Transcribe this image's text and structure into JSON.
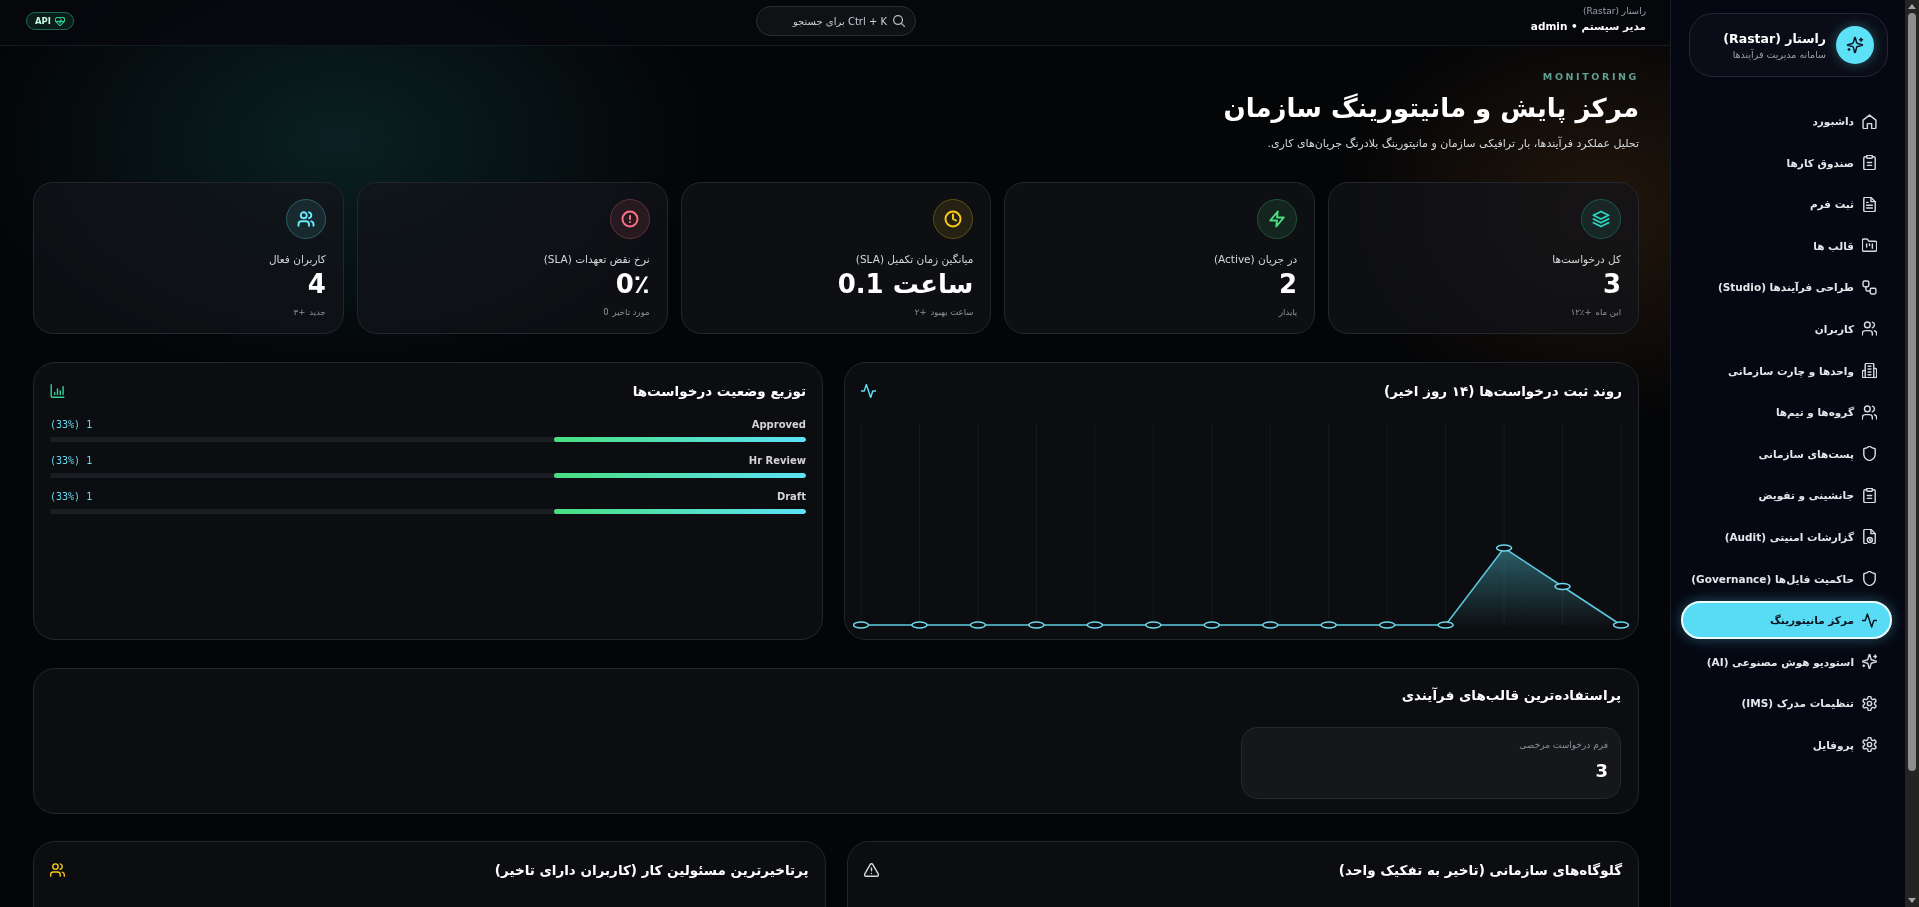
{
  "sidebar": {
    "brand": {
      "title": "راستار (Rastar)",
      "subtitle": "سامانه مدیریت فرآیندها"
    },
    "items": [
      {
        "label": "داشبورد",
        "selected": false
      },
      {
        "label": "صندوق کارها",
        "selected": false
      },
      {
        "label": "ثبت فرم",
        "selected": false
      },
      {
        "label": "قالب ها",
        "selected": false
      },
      {
        "label": "طراحی فرآیندها (Studio)",
        "selected": false
      },
      {
        "label": "کاربران",
        "selected": false
      },
      {
        "label": "واحدها و چارت سازمانی",
        "selected": false
      },
      {
        "label": "گروه‌ها و تیم‌ها",
        "selected": false
      },
      {
        "label": "پست‌های سازمانی",
        "selected": false
      },
      {
        "label": "جانشینی و تفویض",
        "selected": false
      },
      {
        "label": "گزارشات امنیتی (Audit)",
        "selected": false
      },
      {
        "label": "حاکمیت فایل‌ها (Governance)",
        "selected": false
      },
      {
        "label": "مرکز مانیتورینگ",
        "selected": true
      },
      {
        "label": "استودیو هوش مصنوعی (AI)",
        "selected": false
      },
      {
        "label": "تنظیمات مدرک (IMS)",
        "selected": false
      },
      {
        "label": "پروفایل",
        "selected": false
      }
    ]
  },
  "topbar": {
    "caption": "راستار (Rastar)",
    "user": "مدیر سیستم • admin",
    "search": {
      "placeholder": "Ctrl + K برای جستجو"
    },
    "badge": "API"
  },
  "header": {
    "eyebrow": "MONITORING",
    "title": "مرکز پایش و مانیتورینگ سازمان",
    "subtitle": "تحلیل عملکرد فرآیندها، بار ترافیکی سازمان و مانیتورینگ بلادرنگ جریان‌های کاری."
  },
  "stats": [
    {
      "label": "کل درخواست‌ها",
      "value": "3",
      "delta": "+۱۲٪",
      "note": "این ماه",
      "color": "#2dd4bf"
    },
    {
      "label": "در جریان (Active)",
      "value": "2",
      "note": "پایدار",
      "color": "#4ade80"
    },
    {
      "label": "میانگین زمان تکمیل (SLA)",
      "value": "0.1 ساعت",
      "delta": "+۲",
      "note": "ساعت بهبود",
      "color": "#facc15"
    },
    {
      "label": "نرخ نقض تعهدات (SLA)",
      "value": "0٪",
      "delta": "0",
      "note": "مورد تاخیر",
      "color": "#fb7185"
    },
    {
      "label": "کاربران فعال",
      "value": "4",
      "delta": "+۳",
      "note": "جدید",
      "color": "#67e8f9"
    }
  ],
  "trend": {
    "title": "روند ثبت درخواست‌ها (۱۴ روز اخیر)"
  },
  "distribution": {
    "title": "توزیع وضعیت درخواست‌ها",
    "rows": [
      {
        "label": "Approved",
        "count": "1 (33%)",
        "level": 0.333
      },
      {
        "label": "Hr Review",
        "count": "1 (33%)",
        "level": 0.333
      },
      {
        "label": "Draft",
        "count": "1 (33%)",
        "level": 0.333
      }
    ]
  },
  "templates": {
    "title": "پراستفاده‌ترین قالب‌های فرآیندی",
    "items": [
      {
        "name": "فرم درخواست مرخصی",
        "count": "3"
      }
    ]
  },
  "bottlenecks": {
    "title": "گلوگاه‌های سازمانی (تاخیر به تفکیک واحد)"
  },
  "late_users": {
    "title": "پرتاخیرترین مسئولین کار (کاربران دارای تاخیر)"
  }
}
